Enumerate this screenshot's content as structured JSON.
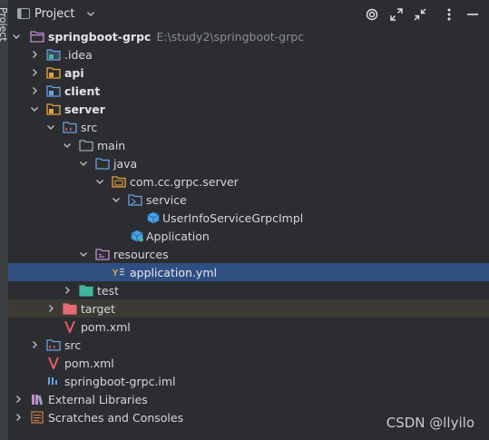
{
  "side_tab": {
    "label": "Project"
  },
  "header": {
    "title": "Project"
  },
  "tree": {
    "root": {
      "label": "springboot-grpc",
      "path": "E:\\study2\\springboot-grpc"
    },
    "idea": ".idea",
    "api": "api",
    "client": "client",
    "server": "server",
    "server_src": "src",
    "main": "main",
    "java": "java",
    "package": "com.cc.grpc.server",
    "service": "service",
    "service_impl": "UserInfoServiceGrpcImpl",
    "application_class": "Application",
    "resources": "resources",
    "application_yml": "application.yml",
    "test": "test",
    "target": "target",
    "server_pom": "pom.xml",
    "root_src": "src",
    "root_pom": "pom.xml",
    "iml": "springboot-grpc.iml",
    "external_libraries": "External Libraries",
    "scratches": "Scratches and Consoles"
  },
  "watermark": "CSDN @llyilo",
  "colors": {
    "background": "#2b2d30",
    "selection": "#2f4f82",
    "excluded_row": "#3d3a35",
    "folder": "#87939a",
    "source_folder": "#6aa1e3",
    "test_folder": "#3fb69e",
    "resource_folder": "#c38bd8",
    "module_folder": "#e8a33d",
    "excluded_folder": "#e06c75",
    "maven": "#e55b6b"
  }
}
